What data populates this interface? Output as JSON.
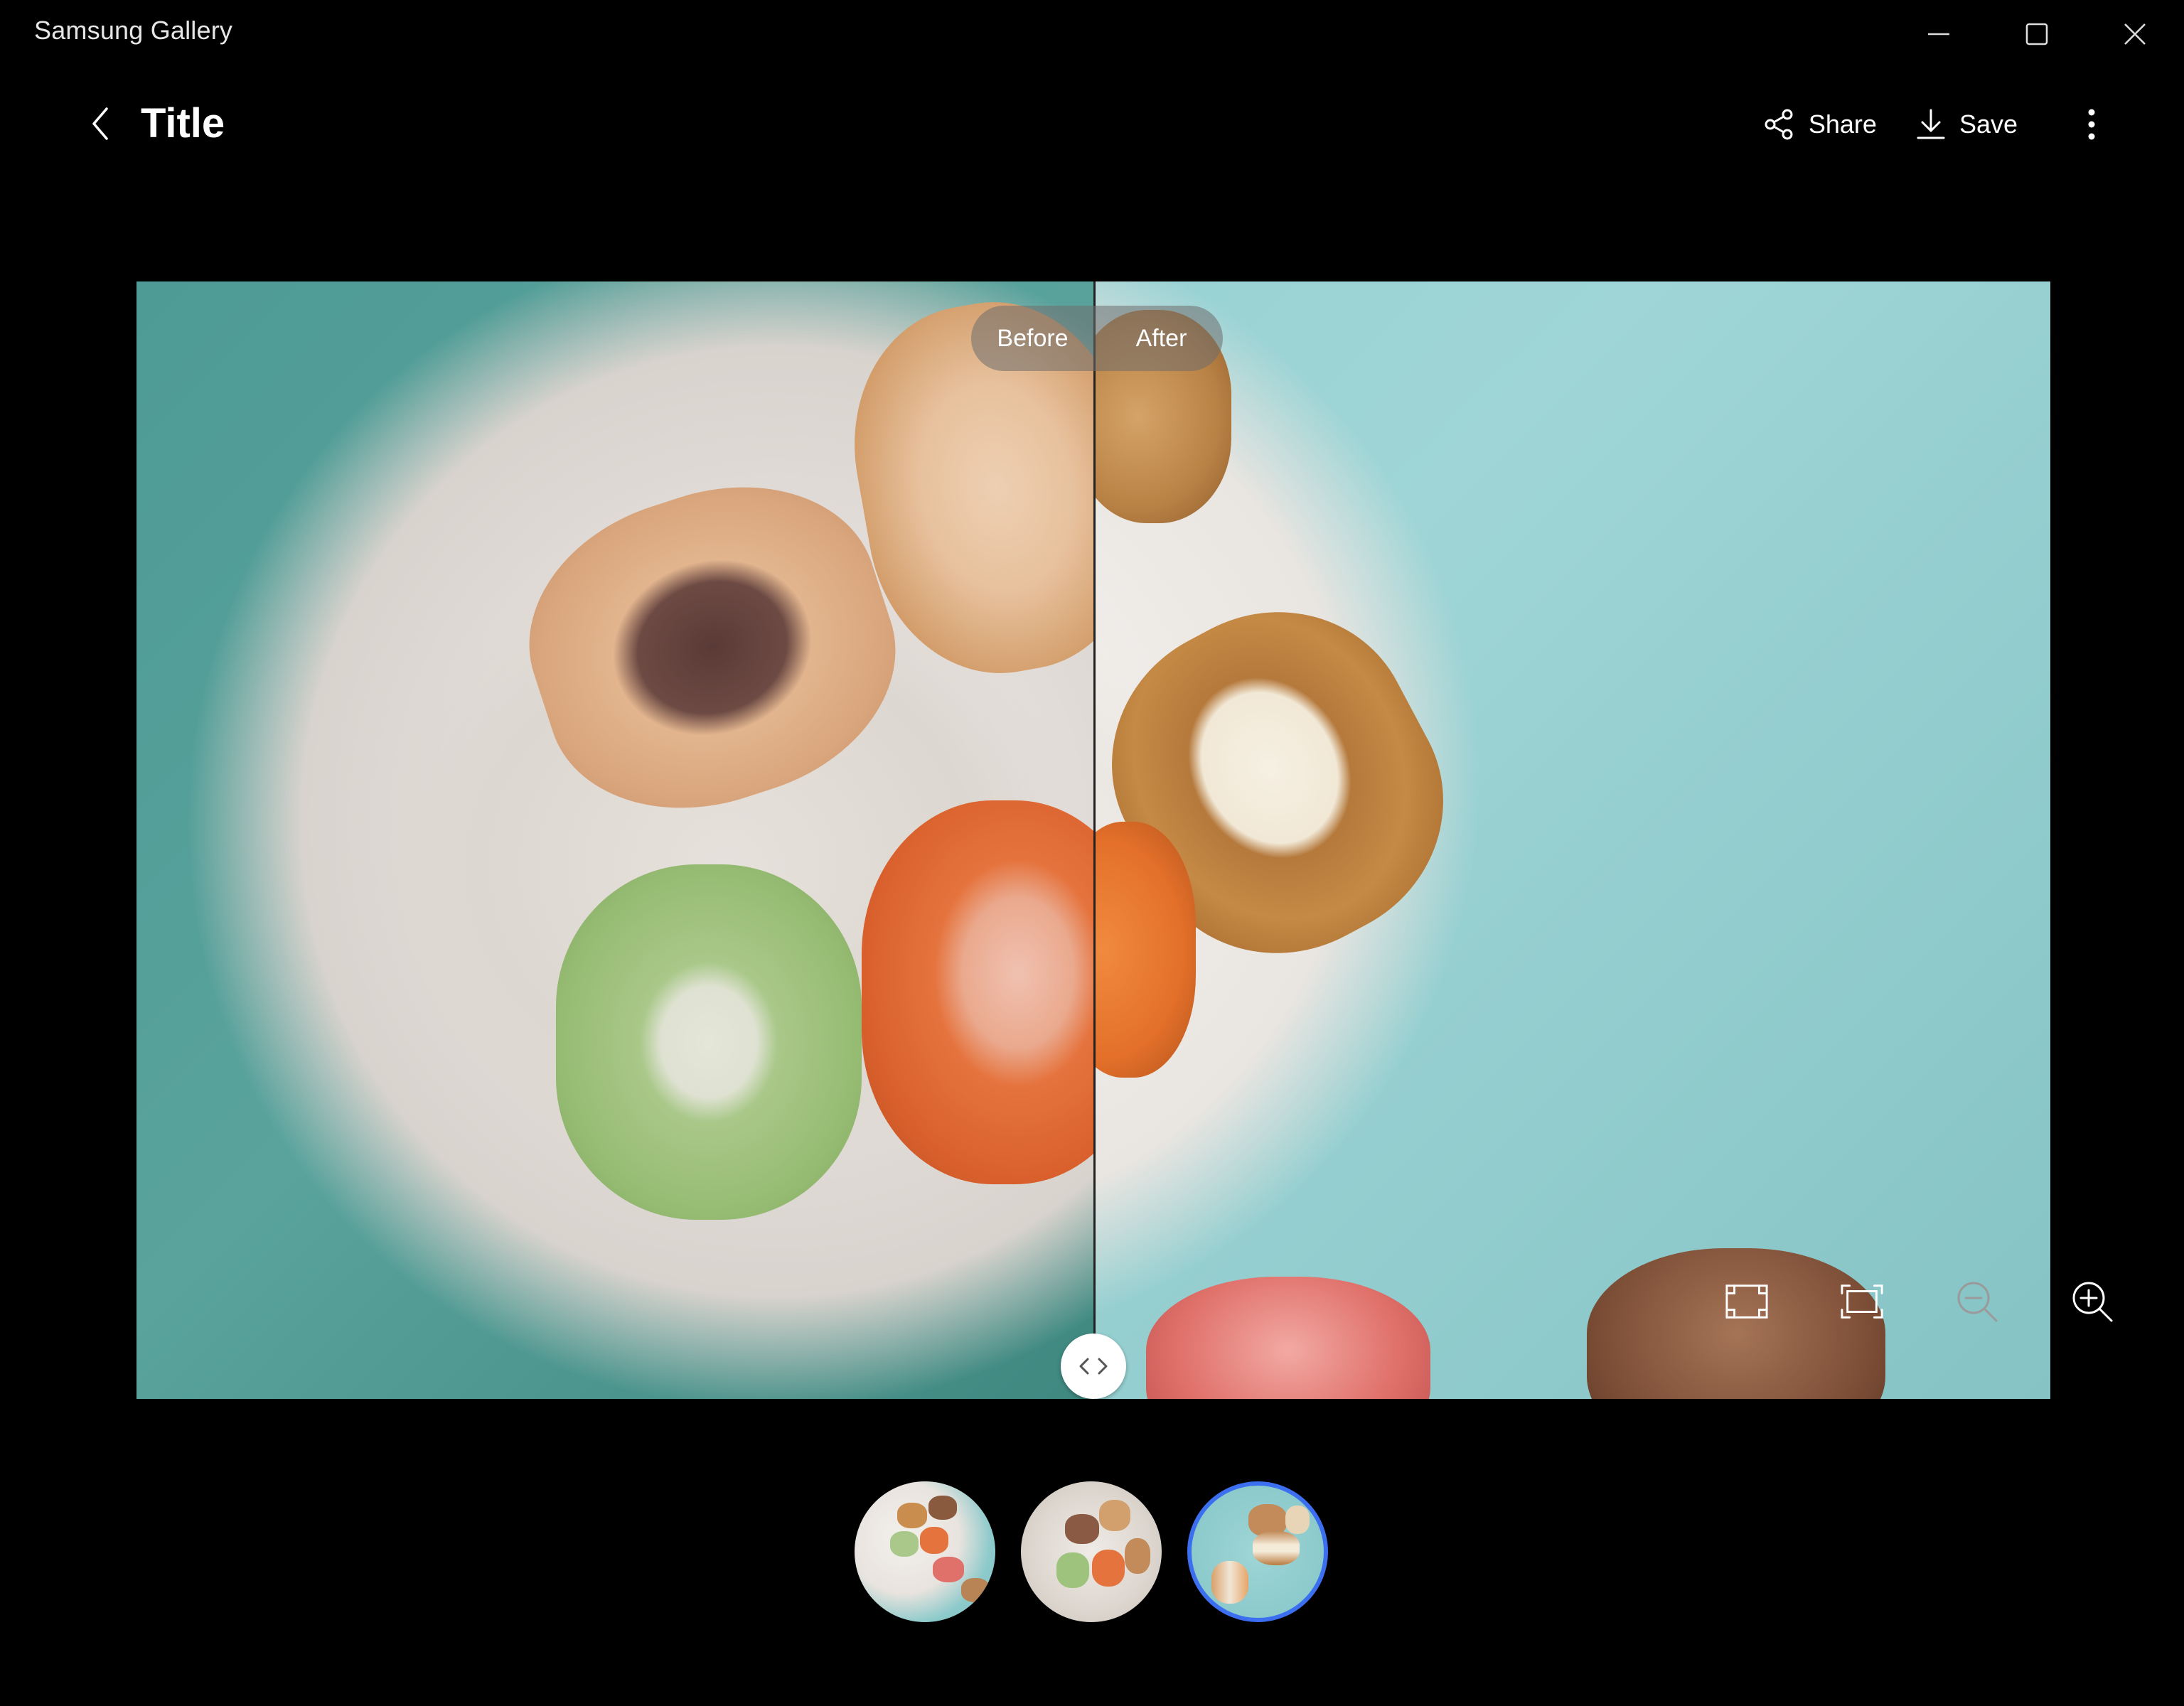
{
  "window": {
    "title": "Samsung Gallery",
    "controls": [
      "minimize-icon",
      "maximize-icon",
      "close-icon"
    ]
  },
  "header": {
    "title": "Title",
    "share_label": "Share",
    "save_label": "Save"
  },
  "compare": {
    "before_label": "Before",
    "after_label": "After"
  },
  "view_controls": [
    "fit-screen-icon",
    "fill-screen-icon",
    "zoom-out-icon",
    "zoom-in-icon"
  ],
  "thumbnails": [
    {
      "name": "macarons-on-plate-wide",
      "selected": false
    },
    {
      "name": "macarons-closeup",
      "selected": false
    },
    {
      "name": "macarons-on-teal",
      "selected": true
    }
  ],
  "colors": {
    "background": "#000000",
    "accent": "#3b6ff0",
    "pill": "#6e6e6e",
    "teal_cloth_after": "#9fd5d6",
    "teal_cloth_before": "#5aa39d"
  }
}
